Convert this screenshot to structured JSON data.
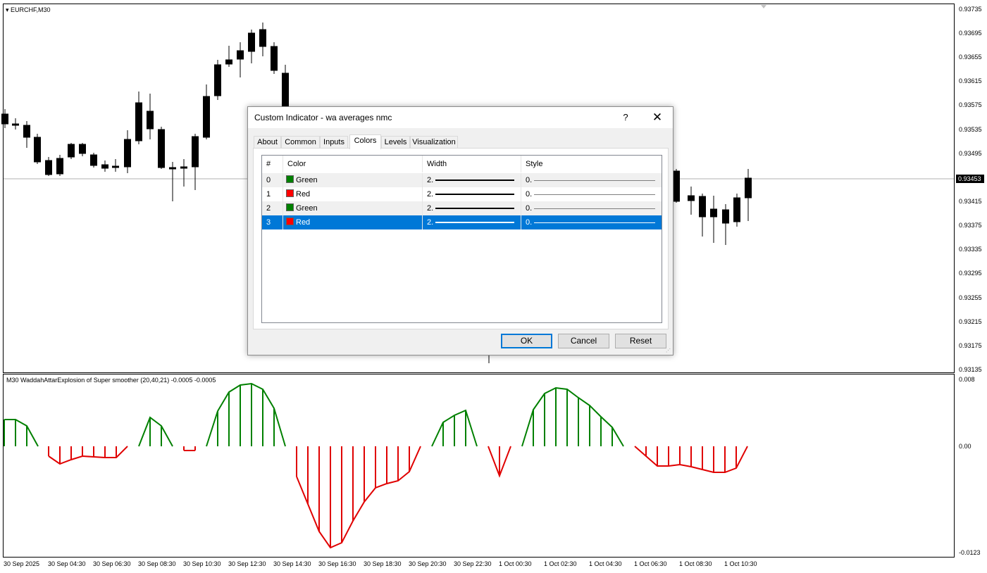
{
  "main_chart": {
    "caption": "EURCHF,M30",
    "price_labels": [
      "0.93735",
      "0.93695",
      "0.93655",
      "0.93615",
      "0.93575",
      "0.93535",
      "0.93495",
      "0.93415",
      "0.93375",
      "0.93335",
      "0.93295",
      "0.93255",
      "0.93215",
      "0.93175",
      "0.93135"
    ],
    "current_price": "0.93453",
    "candle_color_up": "#ffffff",
    "candle_color_down": "#000000"
  },
  "indicator": {
    "caption": "M30  WaddahAttarExplosion of Super smoother (20,40,21) -0.0005 -0.0005",
    "scale_labels": [
      "0.008",
      "0.00",
      "-0.0123"
    ],
    "green": "#008000",
    "red": "#e00000"
  },
  "time_labels": [
    "30 Sep 2025",
    "30 Sep 04:30",
    "30 Sep 06:30",
    "30 Sep 08:30",
    "30 Sep 10:30",
    "30 Sep 12:30",
    "30 Sep 14:30",
    "30 Sep 16:30",
    "30 Sep 18:30",
    "30 Sep 20:30",
    "30 Sep 22:30",
    "1 Oct 00:30",
    "1 Oct 02:30",
    "1 Oct 04:30",
    "1 Oct 06:30",
    "1 Oct 08:30",
    "1 Oct 10:30"
  ],
  "dialog": {
    "title": "Custom Indicator - wa averages nmc",
    "help": "?",
    "close": "✕",
    "tabs": [
      "About",
      "Common",
      "Inputs",
      "Colors",
      "Levels",
      "Visualization"
    ],
    "active_tab": "Colors",
    "columns": [
      "#",
      "Color",
      "Width",
      "Style"
    ],
    "rows": [
      {
        "index": "0",
        "color_name": "Green",
        "color": "#008000",
        "width": "2.",
        "style": "0."
      },
      {
        "index": "1",
        "color_name": "Red",
        "color": "#ff0000",
        "width": "2.",
        "style": "0."
      },
      {
        "index": "2",
        "color_name": "Green",
        "color": "#008000",
        "width": "2.",
        "style": "0."
      },
      {
        "index": "3",
        "color_name": "Red",
        "color": "#ff0000",
        "width": "2.",
        "style": "0."
      }
    ],
    "selected_row": 3,
    "buttons": {
      "ok": "OK",
      "cancel": "Cancel",
      "reset": "Reset"
    }
  }
}
